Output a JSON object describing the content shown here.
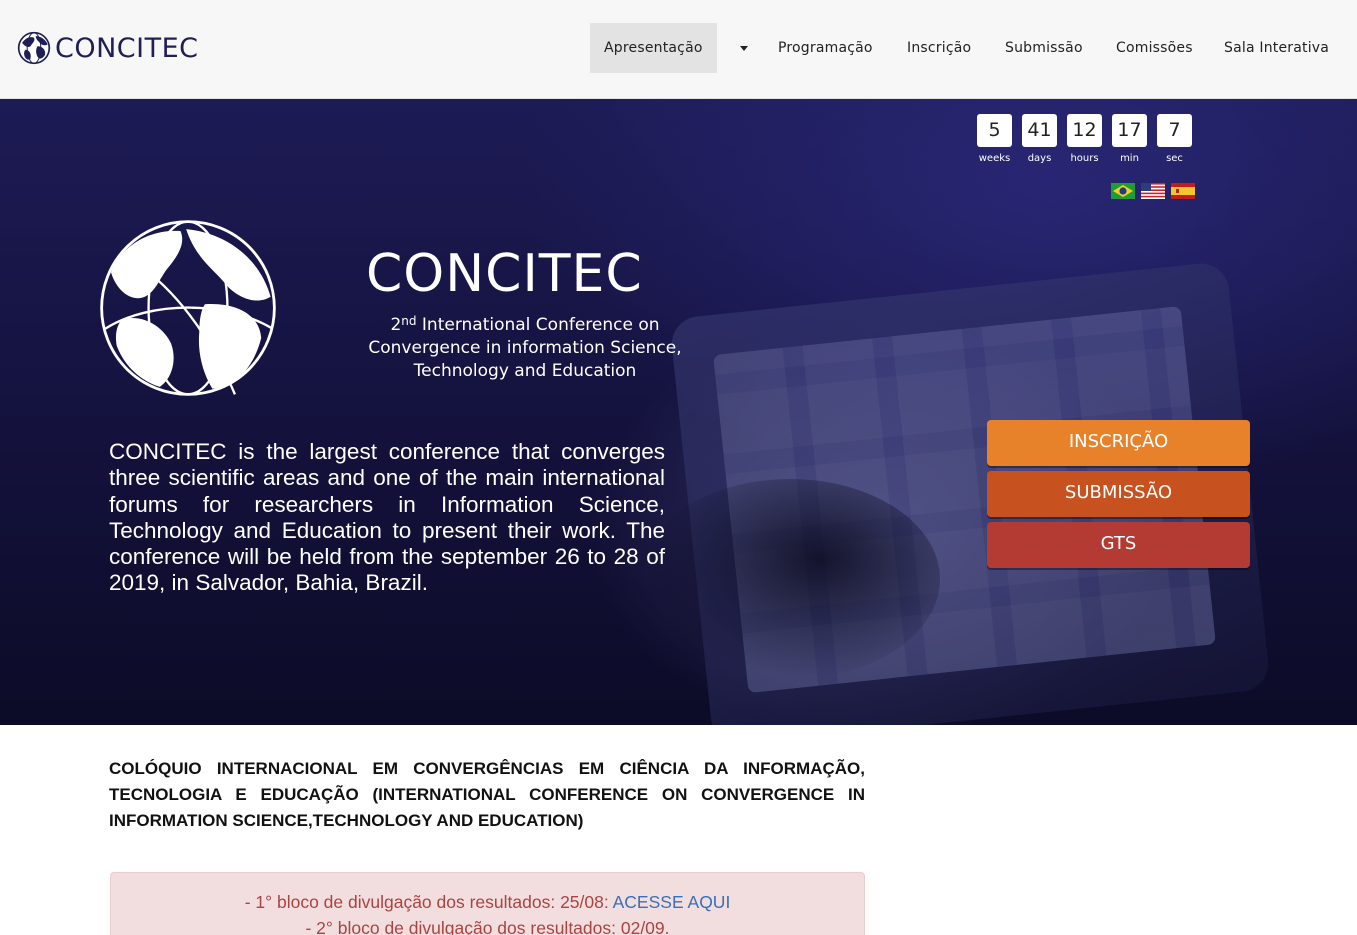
{
  "brand": {
    "name": "CONCITEC"
  },
  "nav": {
    "items": [
      "Apresentação",
      "Programação",
      "Inscrição",
      "Submissão",
      "Comissões",
      "Sala Interativa"
    ]
  },
  "countdown": [
    {
      "value": "5",
      "label": "weeks"
    },
    {
      "value": "41",
      "label": "days"
    },
    {
      "value": "12",
      "label": "hours"
    },
    {
      "value": "17",
      "label": "min"
    },
    {
      "value": "7",
      "label": "sec"
    }
  ],
  "flags": [
    "brazil-flag-icon",
    "usa-flag-icon",
    "spain-flag-icon"
  ],
  "hero": {
    "logo_title": "CONCITEC",
    "logo_sub_ordinal": "2",
    "logo_sub_suffix": "nd",
    "logo_sub_line1": "International Conference on",
    "logo_sub_line2": "Convergence in information Science,",
    "logo_sub_line3": "Technology and  Education",
    "intro": "CONCITEC is the largest conference that converges three scientific areas and one of the main international forums for researchers in Information Science, Technology and Education to present their work. The conference will be held from the september 26 to 28 of 2019, in Salvador, Bahia, Brazil.",
    "buttons": {
      "inscricao": "INSCRIÇÃO",
      "submissao": "SUBMISSÃO",
      "gts": "GTS"
    }
  },
  "content": {
    "title": "COLÓQUIO INTERNACIONAL EM CONVERGÊNCIAS EM CIÊNCIA DA INFORMAÇÃO, TECNOLOGIA E EDUCAÇÃO (INTERNATIONAL CONFERENCE ON CONVERGENCE IN INFORMATION SCIENCE,TECHNOLOGY AND EDUCATION)",
    "alert_line1": "- 1° bloco de divulgação dos resultados: 25/08: ",
    "alert_link": "ACESSE AQUI",
    "alert_line2": "- 2° bloco de divulgação dos resultados: 02/09."
  },
  "colors": {
    "brand": "#1f1f55",
    "btn_inscricao": "#e7822a",
    "btn_submissao": "#c8521f",
    "btn_gts": "#b43a34",
    "alert_text": "#a94442",
    "link": "#3a70b7"
  }
}
